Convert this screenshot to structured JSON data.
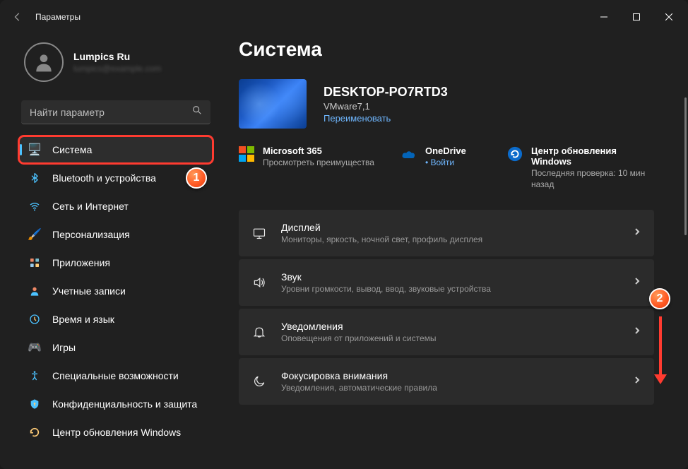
{
  "titlebar": {
    "title": "Параметры"
  },
  "account": {
    "name": "Lumpics Ru",
    "email": "lumpics@example.com"
  },
  "search": {
    "placeholder": "Найти параметр"
  },
  "sidebar": {
    "items": [
      {
        "label": "Система",
        "icon": "monitor-icon",
        "active": true,
        "highlight": true
      },
      {
        "label": "Bluetooth и устройства",
        "icon": "bluetooth-icon"
      },
      {
        "label": "Сеть и Интернет",
        "icon": "wifi-icon"
      },
      {
        "label": "Персонализация",
        "icon": "paintbrush-icon"
      },
      {
        "label": "Приложения",
        "icon": "apps-icon"
      },
      {
        "label": "Учетные записи",
        "icon": "account-icon"
      },
      {
        "label": "Время и язык",
        "icon": "clock-language-icon"
      },
      {
        "label": "Игры",
        "icon": "gamepad-icon"
      },
      {
        "label": "Специальные возможности",
        "icon": "accessibility-icon"
      },
      {
        "label": "Конфиденциальность и защита",
        "icon": "shield-icon"
      },
      {
        "label": "Центр обновления Windows",
        "icon": "windows-update-icon"
      }
    ]
  },
  "main": {
    "heading": "Система",
    "device": {
      "name": "DESKTOP-PO7RTD3",
      "model": "VMware7,1",
      "rename": "Переименовать"
    },
    "services": [
      {
        "title": "Microsoft 365",
        "sub": "Просмотреть преимущества",
        "icon": "ms365-icon"
      },
      {
        "title": "OneDrive",
        "link": "Войти",
        "icon": "onedrive-icon"
      },
      {
        "title": "Центр обновления Windows",
        "sub": "Последняя проверка: 10 мин назад",
        "icon": "windows-update-circle-icon"
      }
    ],
    "settings": [
      {
        "title": "Дисплей",
        "desc": "Мониторы, яркость, ночной свет, профиль дисплея",
        "icon": "display-icon"
      },
      {
        "title": "Звук",
        "desc": "Уровни громкости, вывод, ввод, звуковые устройства",
        "icon": "sound-icon"
      },
      {
        "title": "Уведомления",
        "desc": "Оповещения от приложений и системы",
        "icon": "bell-icon"
      },
      {
        "title": "Фокусировка внимания",
        "desc": "Уведомления, автоматические правила",
        "icon": "moon-icon"
      }
    ]
  },
  "annotations": {
    "badge1": "1",
    "badge2": "2"
  }
}
